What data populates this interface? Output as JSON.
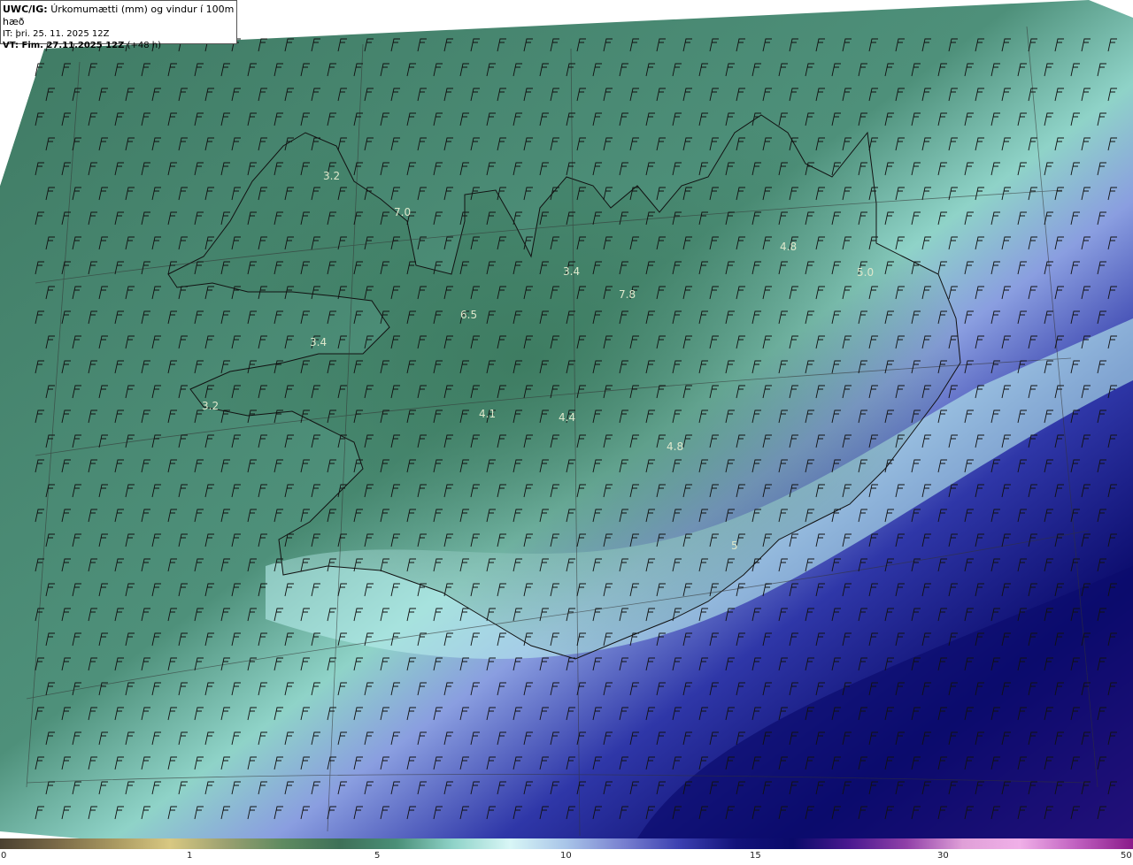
{
  "header": {
    "model": "UWC/IG:",
    "title": "Úrkomumætti (mm) og vindur í 100m hæð",
    "issue_time": "IT: þri. 25. 11. 2025 12Z",
    "valid_prefix": "VT: Fim. 27.11.2025 12Z",
    "valid_lead": "(+48 h)"
  },
  "colorbar": {
    "ticks": [
      "0",
      "1",
      "5",
      "10",
      "15",
      "30",
      "50"
    ],
    "colors": [
      "#4a4030",
      "#7a6a48",
      "#a89860",
      "#d8c882",
      "#9aa070",
      "#5e8a60",
      "#3e7058",
      "#4a8f78",
      "#8fd3c8",
      "#d8f6f6",
      "#a8c4e8",
      "#7880d0",
      "#3b3fb0",
      "#12127a",
      "#0a0a6a",
      "#4a1890",
      "#9040a8",
      "#e0a0d8",
      "#f0b0e8",
      "#c060c0",
      "#8a1a8a"
    ]
  },
  "labels": [
    "3.2",
    "7.0",
    "3.4",
    "7.8",
    "4.8",
    "5.0",
    "6.5",
    "3.4",
    "3.2",
    "4.1",
    "4.4",
    "4.8",
    "5"
  ]
}
